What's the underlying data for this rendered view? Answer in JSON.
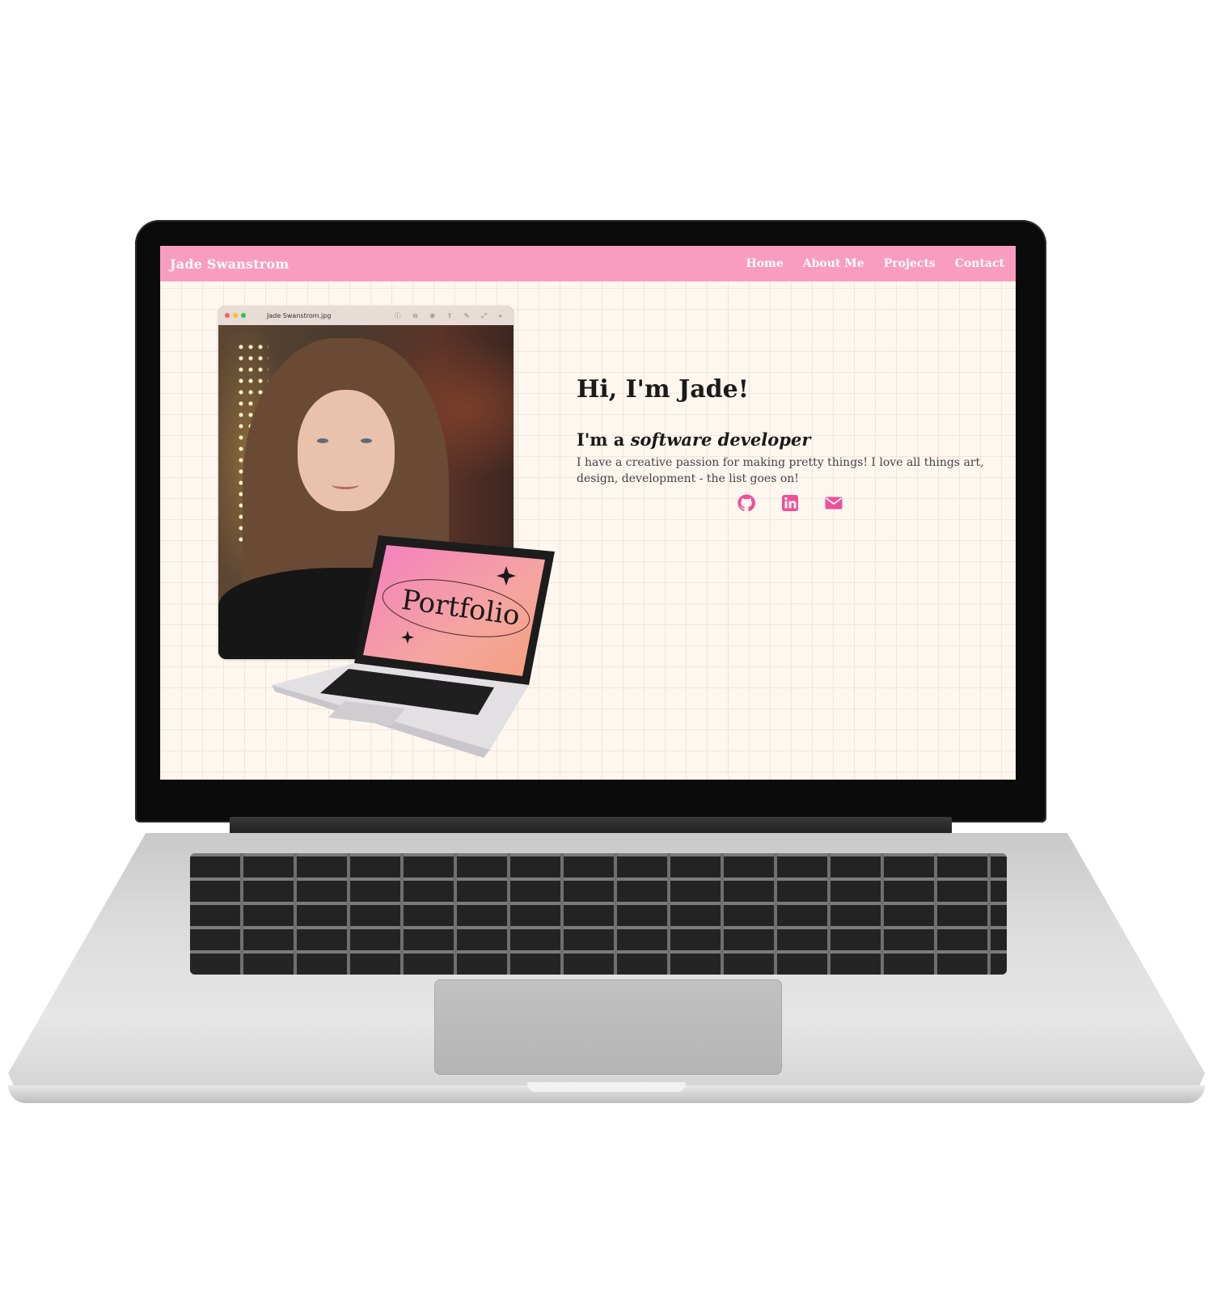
{
  "nav": {
    "brand": "Jade Swanstrom",
    "links": [
      "Home",
      "About Me",
      "Projects",
      "Contact"
    ]
  },
  "photo_window": {
    "filename": "Jade Swanstrom.jpg"
  },
  "mini_laptop": {
    "screen_text": "Portfolio"
  },
  "hero": {
    "greeting": "Hi, I'm Jade!",
    "role_prefix": "I'm a",
    "role": "software developer",
    "description": "I have a creative passion for making pretty things! I love all things art, design, development - the list goes on!"
  },
  "socials": [
    "github-icon",
    "linkedin-icon",
    "mail-icon"
  ],
  "colors": {
    "nav_pink": "#f99dc0",
    "accent_pink": "#ee4f9a",
    "page_bg": "#fdf7ef"
  }
}
